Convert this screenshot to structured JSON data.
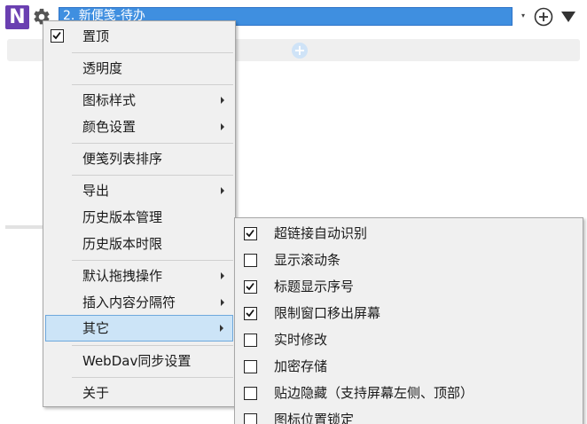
{
  "topbar": {
    "logo_letter": "N",
    "note_title": "2. 新便笺-待办",
    "combo_arrow": "▾"
  },
  "subbar": {
    "plus": "+"
  },
  "main_menu": {
    "items": [
      {
        "label": "置顶",
        "checked": true,
        "submenu": false
      },
      {
        "label": "透明度",
        "submenu": false
      },
      {
        "label": "图标样式",
        "submenu": true
      },
      {
        "label": "颜色设置",
        "submenu": true
      },
      {
        "label": "便笺列表排序",
        "submenu": false
      },
      {
        "label": "导出",
        "submenu": true
      },
      {
        "label": "历史版本管理",
        "submenu": false
      },
      {
        "label": "历史版本时限",
        "submenu": false
      },
      {
        "label": "默认拖拽操作",
        "submenu": true
      },
      {
        "label": "插入内容分隔符",
        "submenu": true
      },
      {
        "label": "其它",
        "submenu": true,
        "active": true
      },
      {
        "label": "WebDav同步设置",
        "submenu": false
      },
      {
        "label": "关于",
        "submenu": false
      }
    ]
  },
  "other_submenu": {
    "items": [
      {
        "label": "超链接自动识别",
        "checked": true
      },
      {
        "label": "显示滚动条",
        "checked": false
      },
      {
        "label": "标题显示序号",
        "checked": true
      },
      {
        "label": "限制窗口移出屏幕",
        "checked": true
      },
      {
        "label": "实时修改",
        "checked": false
      },
      {
        "label": "加密存储",
        "checked": false
      },
      {
        "label": "贴边隐藏（支持屏幕左侧、顶部）",
        "checked": false
      },
      {
        "label": "图标位置锁定",
        "checked": false
      }
    ]
  },
  "colors": {
    "accent": "#3f8fe0",
    "logo": "#6a3fb1",
    "menu_bg": "#f0f0f0",
    "highlight": "#cce4f7"
  }
}
